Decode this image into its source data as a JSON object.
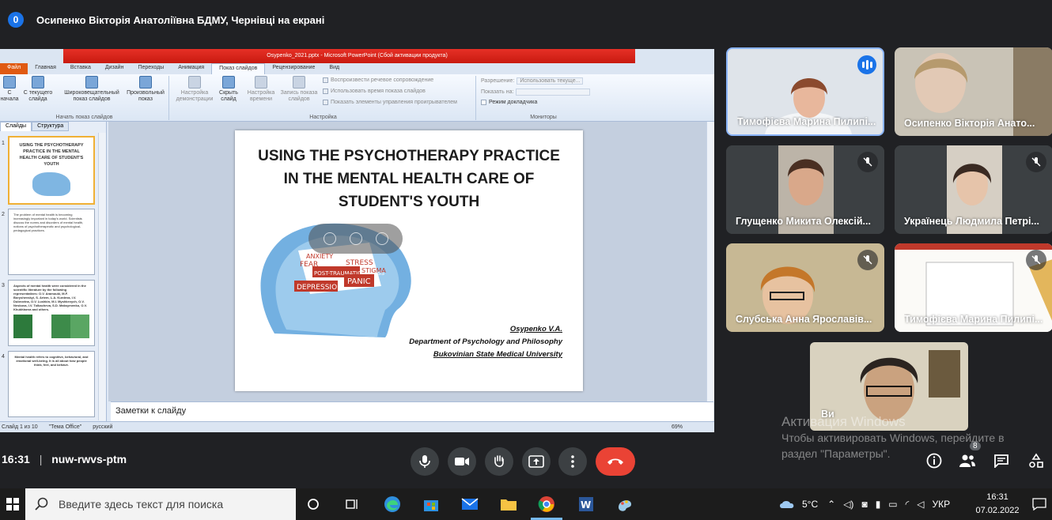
{
  "top": {
    "badge": "0",
    "title": "Осипенко Вікторія Анатоліївна БДМУ, Чернівці на екрані"
  },
  "ppt": {
    "window_title": "Osypenko_2021.pptx - Microsoft PowerPoint (Сбой активации продукта)",
    "tabs": [
      "Файл",
      "Главная",
      "Вставка",
      "Дизайн",
      "Переходы",
      "Анимация",
      "Показ слайдов",
      "Рецензирование",
      "Вид"
    ],
    "ribbon": {
      "b_from_start": "С начала",
      "b_current": "С текущего слайда",
      "b_broadcast": "Широковещательный показ слайдов",
      "b_custom": "Произвольный показ",
      "g_start": "Начать показ слайдов",
      "b_setup": "Настройка демонстрации",
      "b_hide": "Скрыть слайд",
      "b_rehearse": "Настройка времени",
      "b_record": "Запись показа слайдов",
      "c_narr": "Воспроизвести речевое сопровождение",
      "c_timing": "Использовать время показа слайдов",
      "c_media": "Показать элементы управления проигрывателем",
      "g_setup": "Настройка",
      "resolution_label": "Разрешение:",
      "resolution_value": "Использовать текуще...",
      "show_on_label": "Показать на:",
      "presenter": "Режим докладчика",
      "g_monitors": "Мониторы"
    },
    "pane_tabs": [
      "Слайды",
      "Структура"
    ],
    "thumbs": {
      "t1_title": "USING THE PSYCHOTHERAPY PRACTICE IN THE MENTAL HEALTH CARE OF STUDENT'S YOUTH",
      "t2": "The problem of mental health is becoming increasingly important in today's world. Scientists discuss the norms and disorders of mental health, notions of psychotherapeutic and psychological-pedagogical practices.",
      "t3": "Aspects of mental health were considered in the scientific literature by the following representatives: O.V. Aramouki, M.F. Boryshevskyi, S. Artem, L.A. Kurdeva, I.V. Dubrovina, O.V. Lushkin, M.I. Myshkevych, O.V. Neskova, I.V. Tolkacheva, S.D. Maksymenko, O.V. Khukhlaeva and others.",
      "t4": "Mental health refers to cognitive, behavioral, and emotional well-being. It is all about how people think, feel, and behave."
    },
    "slide": {
      "title": "USING THE PSYCHOTHERAPY PRACTICE IN THE MENTAL HEALTH CARE  OF STUDENT'S YOUTH",
      "author": "Osypenko V.A.",
      "dept": "Department of Psychology and Philosophy",
      "univ": "Bukovinian State Medical University",
      "art_words": [
        "ANXIETY",
        "STRESS",
        "PANIC",
        "DEPRESSION",
        "FEAR",
        "STIGMA",
        "POST-TRAUMATIC STRESS"
      ]
    },
    "notes": "Заметки к слайду",
    "status": {
      "slide": "Слайд 1 из 10",
      "theme": "\"Тема Office\"",
      "lang": "русский",
      "zoom": "69%"
    }
  },
  "tiles": [
    {
      "name": "Тимофієва Марина Пилипі..."
    },
    {
      "name": "Осипенко Вікторія Анато..."
    },
    {
      "name": "Глущенко Микита Олексій..."
    },
    {
      "name": "Українець Людмила Петрі..."
    },
    {
      "name": "Слубська Анна Ярославів..."
    },
    {
      "name": "Тимофієва Марина Пилипі..."
    },
    {
      "name": "Ви"
    }
  ],
  "bottom": {
    "time": "16:31",
    "code": "nuw-rwvs-ptm",
    "people_count": "8"
  },
  "watermark": {
    "line1": "Активация Windows",
    "line2": "Чтобы активировать Windows, перейдите в",
    "line3": "раздел \"Параметры\"."
  },
  "taskbar": {
    "search_placeholder": "Введите здесь текст для поиска",
    "temp": "5°C",
    "lang": "УКР",
    "time": "16:31",
    "date": "07.02.2022"
  },
  "colors": {
    "end_call": "#ea4335",
    "accent": "#1a73e8",
    "meet_bg": "#202124"
  }
}
